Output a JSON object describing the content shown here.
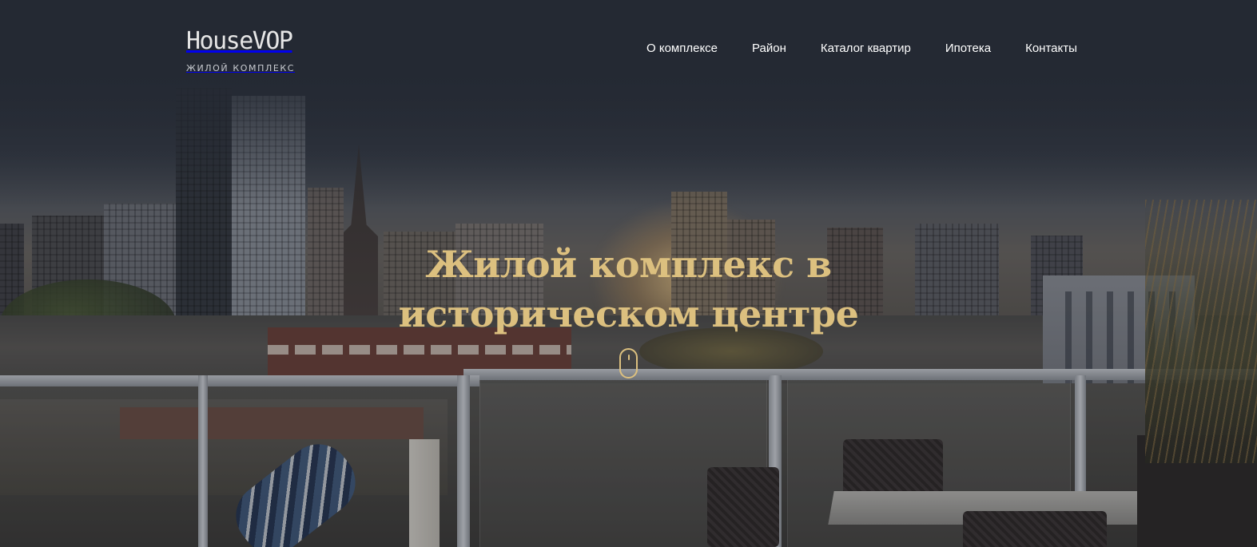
{
  "header": {
    "logo": {
      "name": "HouseVOP",
      "subtitle": "ЖИЛОЙ КОМПЛЕКС"
    },
    "nav": [
      {
        "label": "О комплексе"
      },
      {
        "label": "Район"
      },
      {
        "label": "Каталог квартир"
      },
      {
        "label": "Ипотека"
      },
      {
        "label": "Контакты"
      }
    ]
  },
  "hero": {
    "title_line1": "Жилой комплекс в",
    "title_line2": "историческом центре",
    "scroll_icon": "mouse-scroll-icon"
  },
  "colors": {
    "accent": "#dcc07f",
    "header_bg": "#242933",
    "nav_text": "#ffffff"
  }
}
